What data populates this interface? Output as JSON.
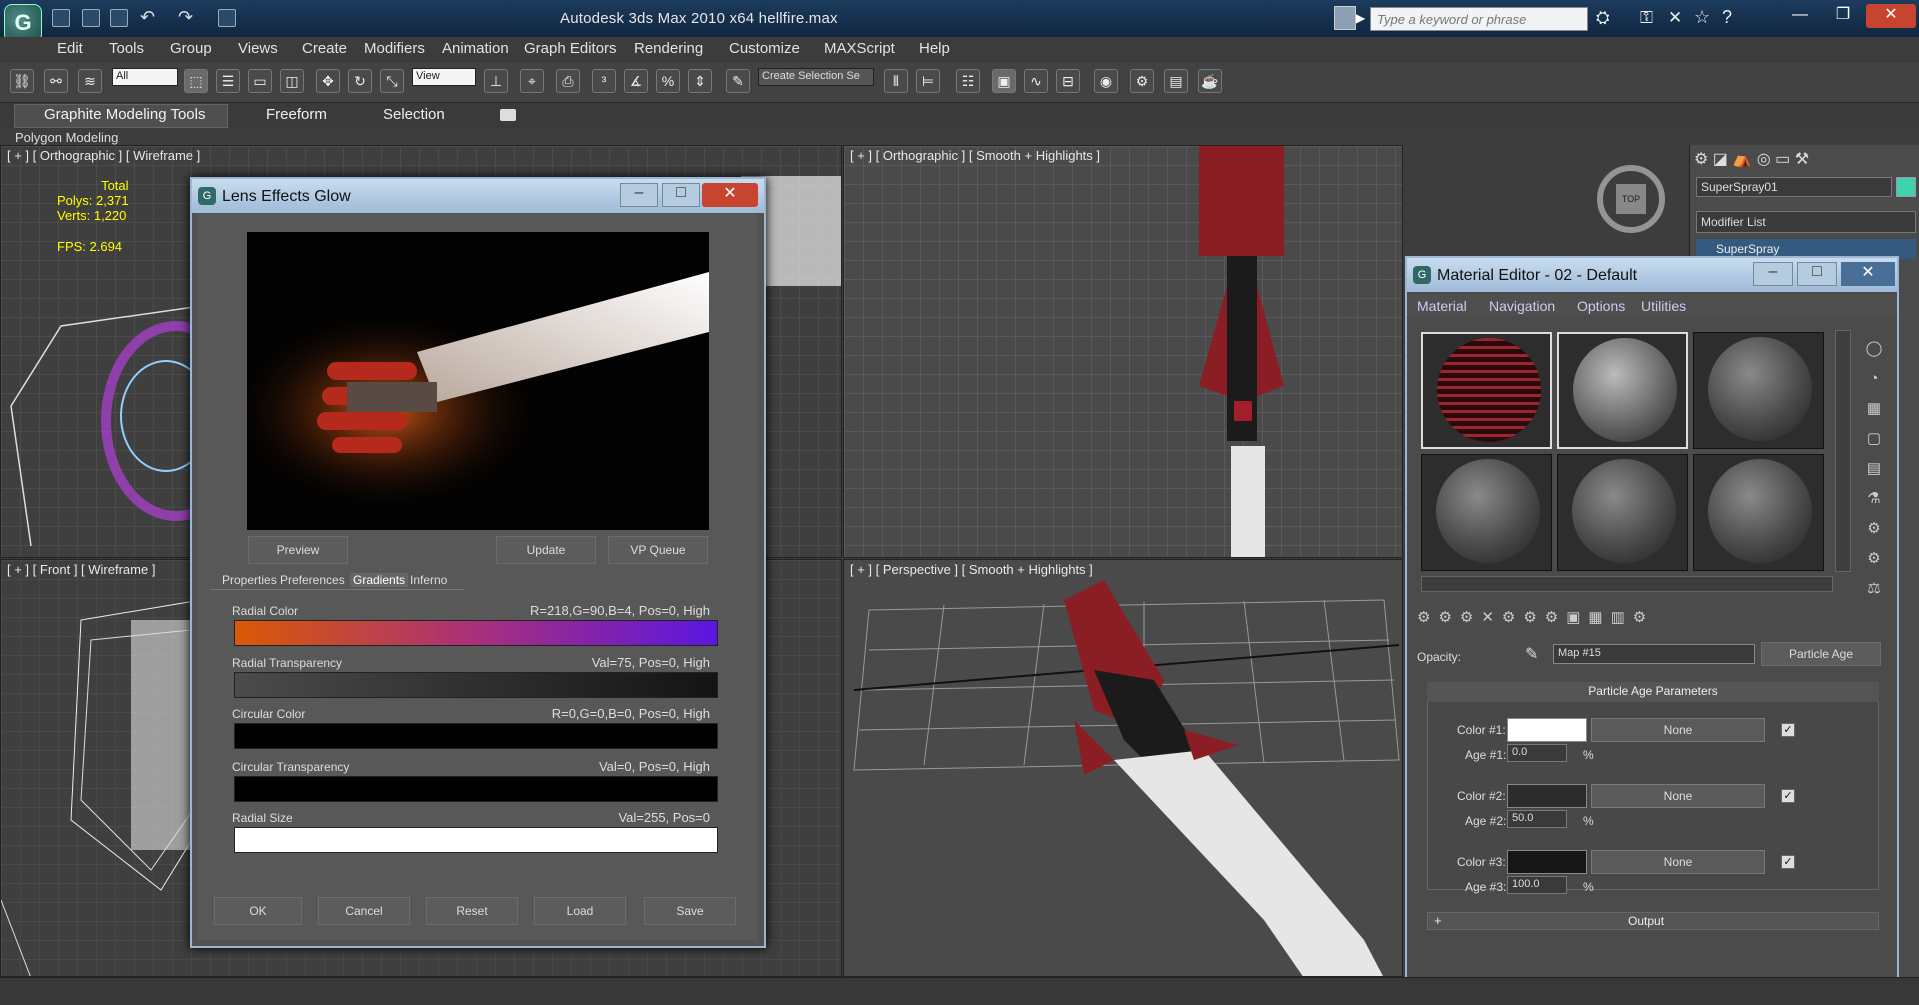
{
  "window": {
    "title": "Autodesk 3ds Max  2010 x64      hellfire.max",
    "search_placeholder": "Type a keyword or phrase"
  },
  "logo": "G",
  "menu": [
    "Edit",
    "Tools",
    "Group",
    "Views",
    "Create",
    "Modifiers",
    "Animation",
    "Graph Editors",
    "Rendering",
    "Customize",
    "MAXScript",
    "Help"
  ],
  "toolbar": {
    "filter_value": "All",
    "ref_coord": "View",
    "named_selection": "Create Selection Se"
  },
  "ribbon": {
    "tabs": [
      "Graphite Modeling Tools",
      "Freeform",
      "Selection"
    ],
    "subtab": "Polygon Modeling"
  },
  "viewports": {
    "top_left": {
      "label": "[ + ] [ Orthographic ] [ Wireframe ]",
      "stats": {
        "total": "Total",
        "polys": "Polys: 2,371",
        "verts": "Verts: 1,220",
        "fps": "FPS:   2.694"
      }
    },
    "top_right": {
      "label": "[ + ] [ Orthographic ] [ Smooth + Highlights ]",
      "cube_label": "TOP"
    },
    "bottom_left": {
      "label": "[ + ] [ Front ] [ Wireframe ]"
    },
    "bottom_right": {
      "label": "[ + ] [ Perspective ] [ Smooth + Highlights ]"
    }
  },
  "command_panel": {
    "object_name": "SuperSpray01",
    "modifier_list": "Modifier List",
    "stack_item": "SuperSpray",
    "name_color": "#3fd1b0"
  },
  "lens_dialog": {
    "title": "Lens Effects Glow",
    "buttons": {
      "preview": "Preview",
      "update": "Update",
      "vp_queue": "VP Queue",
      "ok": "OK",
      "cancel": "Cancel",
      "reset": "Reset",
      "load": "Load",
      "save": "Save"
    },
    "tabs": [
      "Properties",
      "Preferences",
      "Gradients",
      "Inferno"
    ],
    "gradients": [
      {
        "label": "Radial Color",
        "value": "R=218,G=90,B=4, Pos=0, High"
      },
      {
        "label": "Radial Transparency",
        "value": "Val=75, Pos=0, High"
      },
      {
        "label": "Circular Color",
        "value": "R=0,G=0,B=0, Pos=0, High"
      },
      {
        "label": "Circular Transparency",
        "value": "Val=0, Pos=0, High"
      },
      {
        "label": "Radial Size",
        "value": "Val=255, Pos=0"
      }
    ]
  },
  "material_editor": {
    "title": "Material Editor - 02 - Default",
    "menu": [
      "Material",
      "Navigation",
      "Options",
      "Utilities"
    ],
    "opacity_label": "Opacity:",
    "map_value": "Map #15",
    "map_type": "Particle Age",
    "rollout_title": "Particle Age Parameters",
    "rows": [
      {
        "color_label": "Color #1:",
        "swatch": "#ffffff",
        "none": "None",
        "age_label": "Age #1:",
        "age": "0.0",
        "unit": "%"
      },
      {
        "color_label": "Color #2:",
        "swatch": "#2c2c2c",
        "none": "None",
        "age_label": "Age #2:",
        "age": "50.0",
        "unit": "%"
      },
      {
        "color_label": "Color #3:",
        "swatch": "#171717",
        "none": "None",
        "age_label": "Age #3:",
        "age": "100.0",
        "unit": "%"
      }
    ],
    "output_label": "Output",
    "output_plus": "+"
  }
}
